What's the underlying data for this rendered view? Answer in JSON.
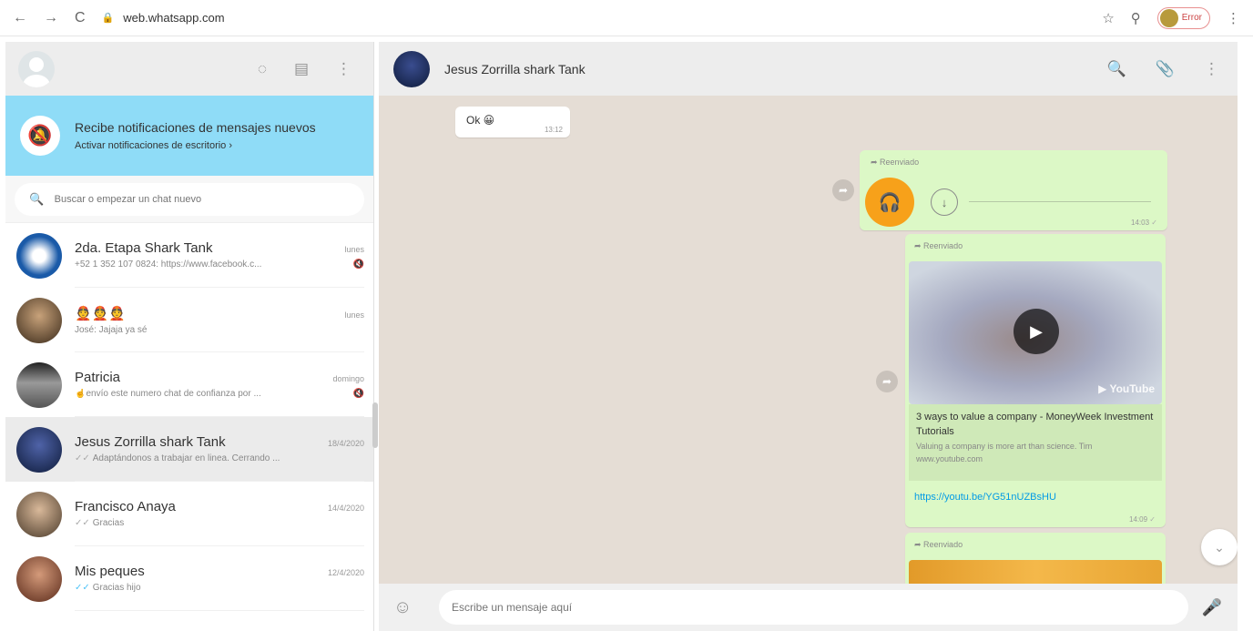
{
  "browser": {
    "back": "←",
    "forward": "→",
    "reload": "C",
    "url": "web.whatsapp.com",
    "profile_label": "Error"
  },
  "sidebar": {
    "notification": {
      "title": "Recibe notificaciones de mensajes nuevos",
      "action": "Activar notificaciones de escritorio ›"
    },
    "search_placeholder": "Buscar o empezar un chat nuevo",
    "chats": [
      {
        "name": "2da. Etapa Shark Tank",
        "time": "lunes",
        "message": "+52 1 352 107 0824: https://www.facebook.c...",
        "muted": true,
        "avatar_color": "#1a5aa8"
      },
      {
        "name": "👲👲👲",
        "time": "lunes",
        "message": "José: Jajaja ya sé",
        "muted": false,
        "avatar_color": "#5a4a3a"
      },
      {
        "name": "Patricia",
        "time": "domingo",
        "message": "☝️envío este numero chat de confianza por ...",
        "muted": true,
        "avatar_color": "#6a6a6a"
      },
      {
        "name": "Jesus Zorrilla shark Tank",
        "time": "18/4/2020",
        "message": "Adaptándonos a trabajar en linea. Cerrando ...",
        "muted": false,
        "avatar_color": "#203a7a"
      },
      {
        "name": "Francisco Anaya",
        "time": "14/4/2020",
        "message": "Gracias",
        "muted": false,
        "avatar_color": "#7a6a5a"
      },
      {
        "name": "Mis peques",
        "time": "12/4/2020",
        "message": "Gracias hijo",
        "muted": false,
        "avatar_color": "#8a5a4a"
      }
    ]
  },
  "conversation": {
    "title": "Jesus Zorrilla shark Tank",
    "messages": {
      "m1_text": "Ok 😀",
      "m1_time": "13:12",
      "forwarded_label": "Reenviado",
      "audio_time": "14:03",
      "link_title": "3 ways to value a company - MoneyWeek Investment Tutorials",
      "link_desc": "Valuing a company is more art than science. Tim",
      "link_domain": "www.youtube.com",
      "link_url": "https://youtu.be/YG51nUZBsHU",
      "link_time": "14:09",
      "youtube_label": "YouTube"
    },
    "compose_placeholder": "Escribe un mensaje aquí"
  }
}
